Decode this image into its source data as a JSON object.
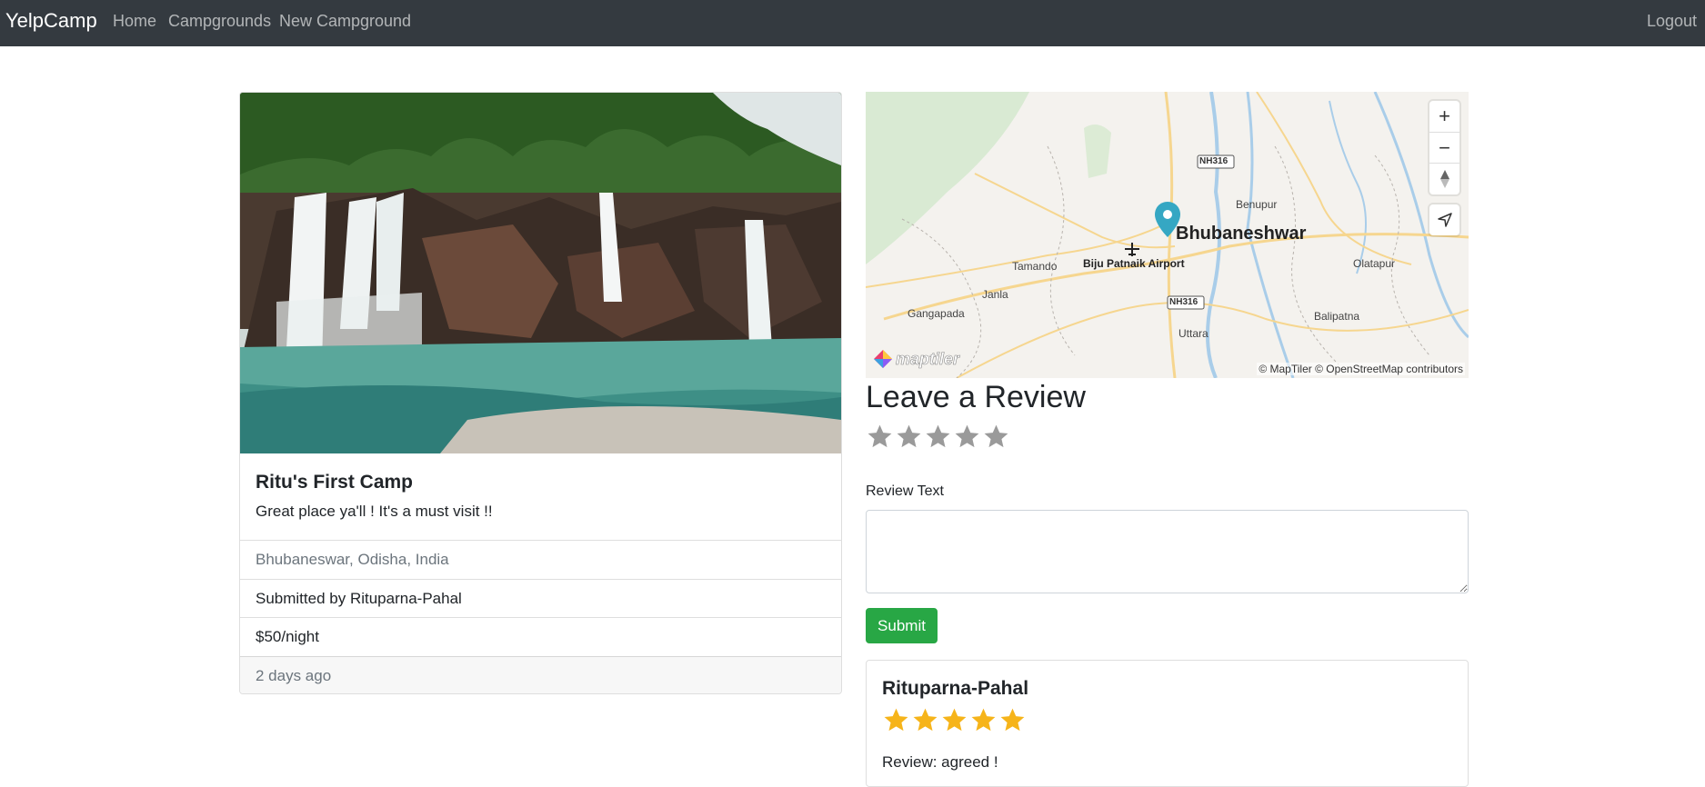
{
  "navbar": {
    "brand": "YelpCamp",
    "links": [
      "Home",
      "Campgrounds",
      "New Campground"
    ],
    "logout": "Logout"
  },
  "campground": {
    "title": "Ritu's First Camp",
    "description": "Great place ya'll ! It's a must visit !!",
    "location": "Bhubaneswar, Odisha, India",
    "submitted_by": "Submitted by Rituparna-Pahal",
    "price": "$50/night",
    "posted": "2 days ago"
  },
  "map": {
    "marker_label": "Bhubaneshwar",
    "place_labels": [
      "Tamando",
      "Biju Patnaik Airport",
      "Janla",
      "Gangapada",
      "Uttara",
      "Balipatna",
      "Benupur",
      "Olatapur"
    ],
    "road_labels": [
      "NH316",
      "NH316"
    ],
    "attribution": "© MapTiler © OpenStreetMap contributors",
    "logo": "maptiler",
    "colors": {
      "land": "#f4f2ee",
      "park": "#d9ead3",
      "water": "#a9cde9",
      "road": "#f6d68f",
      "marker": "#35a7c3"
    }
  },
  "review_form": {
    "heading": "Leave a Review",
    "rating": 0,
    "rating_max": 5,
    "text_label": "Review Text",
    "submit_label": "Submit"
  },
  "reviews": [
    {
      "author": "Rituparna-Pahal",
      "rating": 5,
      "body": "Review: agreed !"
    }
  ],
  "colors": {
    "navbar": "#343a40",
    "submit": "#28a745",
    "star_filled": "#f6b41a",
    "star_empty": "#9a9a9a"
  }
}
